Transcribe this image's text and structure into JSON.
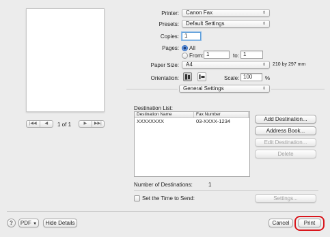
{
  "printer": {
    "label": "Printer:",
    "value": "Canon Fax"
  },
  "presets": {
    "label": "Presets:",
    "value": "Default Settings"
  },
  "copies": {
    "label": "Copies:",
    "value": "1"
  },
  "pages": {
    "label": "Pages:",
    "all": "All",
    "from_label": "From:",
    "from_value": "1",
    "to_label": "to:",
    "to_value": "1"
  },
  "paper_size": {
    "label": "Paper Size:",
    "value": "A4",
    "dimensions": "210 by 297 mm"
  },
  "orientation": {
    "label": "Orientation:",
    "scale_label": "Scale:",
    "scale_value": "100",
    "scale_unit": "%"
  },
  "section": {
    "value": "General Settings"
  },
  "preview": {
    "page_indicator": "1 of 1"
  },
  "destinations": {
    "list_label": "Destination List:",
    "columns": [
      "Destination Name",
      "Fax Number"
    ],
    "rows": [
      {
        "name": "XXXXXXXX",
        "fax": "03-XXXX-1234"
      }
    ],
    "count_label": "Number of Destinations:",
    "count_value": "1"
  },
  "buttons": {
    "add_destination": "Add Destination...",
    "address_book": "Address Book...",
    "edit_destination": "Edit Destination...",
    "delete": "Delete",
    "settings": "Settings...",
    "pdf": "PDF",
    "hide_details": "Hide Details",
    "cancel": "Cancel",
    "print": "Print"
  },
  "send_time": {
    "label": "Set the Time to Send:"
  },
  "colors": {
    "highlight": "#d9161c",
    "focus": "#5b9dd9"
  },
  "icons": [
    "arrows-updown-icon",
    "first-page-icon",
    "prev-page-icon",
    "next-page-icon",
    "last-page-icon",
    "portrait-icon",
    "landscape-icon",
    "help-icon",
    "dropdown-arrow-icon"
  ]
}
